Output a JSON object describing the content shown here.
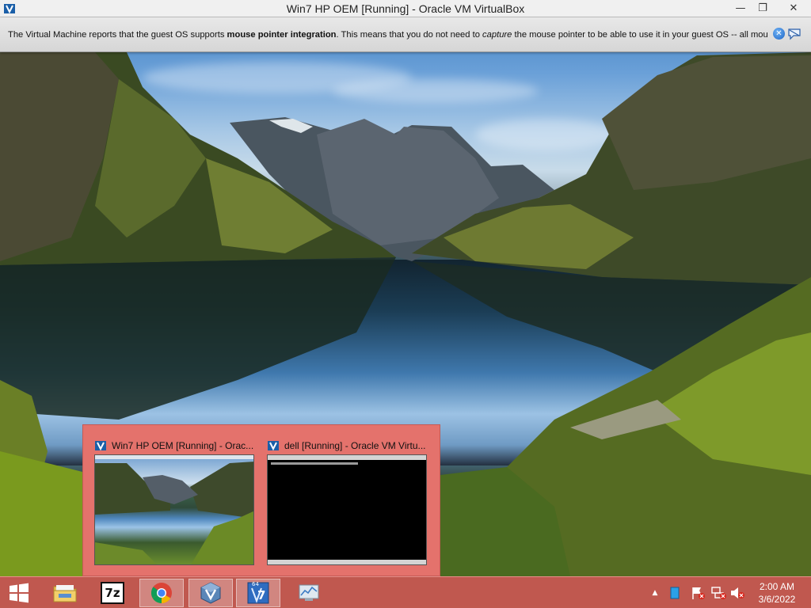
{
  "window": {
    "title": "Win7 HP OEM [Running] - Oracle VM VirtualBox",
    "icons": {
      "app": "virtualbox-icon",
      "minimize": "minimize-icon",
      "maximize": "restore-icon",
      "close": "close-icon"
    },
    "minimize_glyph": "—",
    "restore_glyph": "❐",
    "close_glyph": "✕"
  },
  "banner": {
    "part1": "The Virtual Machine reports that the guest OS supports ",
    "bold": "mouse pointer integration",
    "part2": ". This means that you do not need to ",
    "italic": "capture",
    "part3": " the mouse pointer to be able to use it in your guest OS -- all mouse",
    "close_glyph": "✕",
    "icons": {
      "close": "close-icon",
      "do_not_show": "speech-bubble-icon"
    },
    "colors": {
      "close": "#1d64c6"
    }
  },
  "thumbnails": [
    {
      "title": "Win7 HP OEM [Running] - Orac...",
      "icon": "virtualbox-icon",
      "preview": "desktop-landscape"
    },
    {
      "title": "dell [Running] - Oracle VM Virtu...",
      "icon": "virtualbox-icon",
      "preview": "black-console"
    }
  ],
  "taskbar": {
    "buttons": [
      {
        "name": "start",
        "icon": "windows-logo-icon"
      },
      {
        "name": "file-explorer",
        "icon": "folder-icon"
      },
      {
        "name": "7-zip",
        "icon": "7zip-icon",
        "label": "7z"
      },
      {
        "name": "chrome",
        "icon": "chrome-icon"
      },
      {
        "name": "virtualbox",
        "icon": "virtualbox-icon"
      },
      {
        "name": "virtualbox-win7",
        "icon": "virtualbox-win7-icon",
        "label": "64",
        "label2": "7"
      },
      {
        "name": "resource-monitor",
        "icon": "monitor-icon"
      }
    ],
    "tray": {
      "chevron": "▲",
      "icons": [
        "blue-square-icon",
        "flag-alert-icon",
        "network-alert-icon",
        "speaker-muted-icon"
      ]
    },
    "clock": {
      "time": "2:00 AM",
      "date": "3/6/2022"
    },
    "colors": {
      "taskbar": "#cd5a54",
      "thumb_panel": "#e4726c"
    }
  }
}
